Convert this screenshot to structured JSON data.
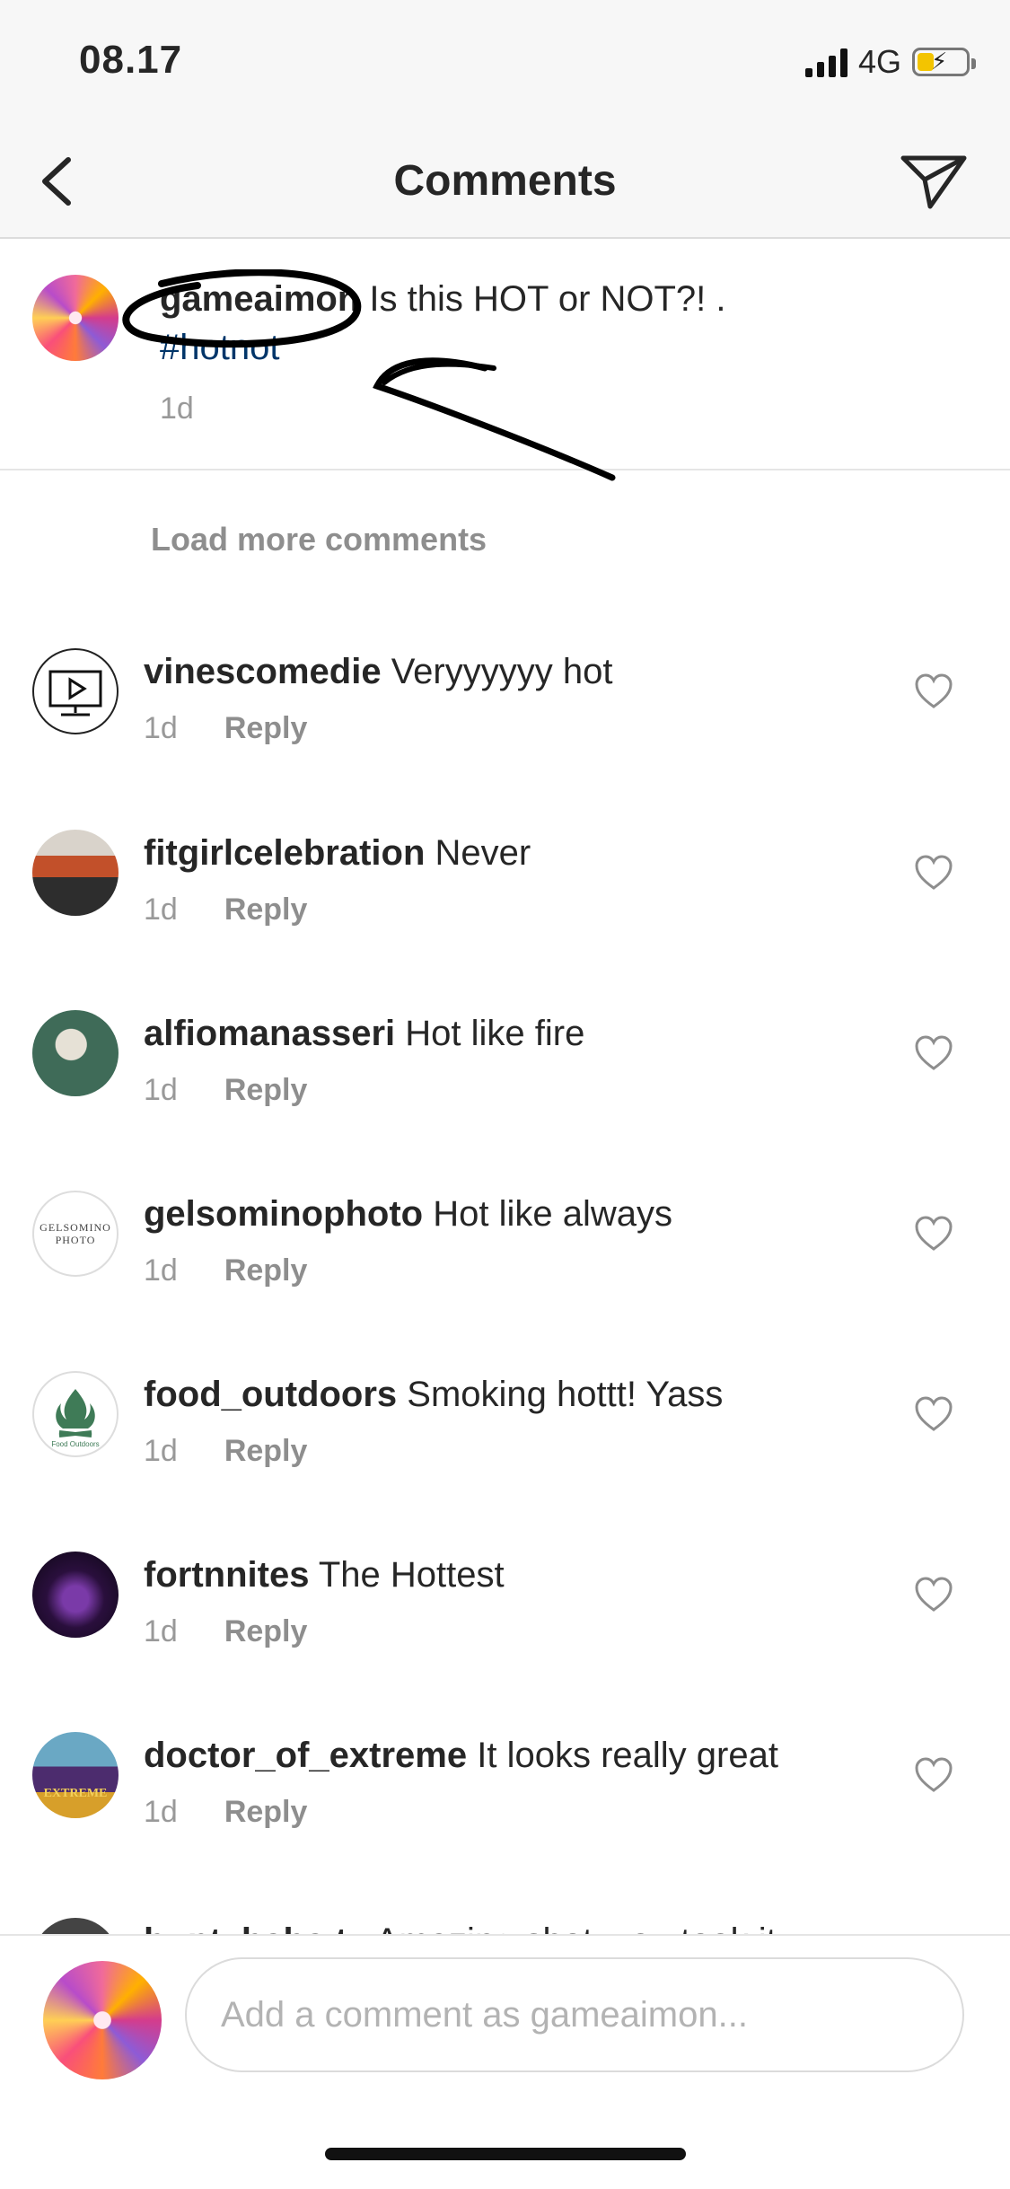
{
  "status_bar": {
    "time": "08.17",
    "network": "4G",
    "battery_level": 0.35
  },
  "nav": {
    "title": "Comments"
  },
  "caption": {
    "username": "gameaimon",
    "text": " Is this HOT or NOT?! .",
    "hashtag": "#hotnot",
    "time": "1d"
  },
  "load_more": "Load more comments",
  "comments": [
    {
      "username": "vinescomedie",
      "text": "Veryyyyyy hot",
      "time": "1d",
      "reply": "Reply"
    },
    {
      "username": "fitgirlcelebration",
      "text": "Never",
      "time": "1d",
      "reply": "Reply"
    },
    {
      "username": "alfiomanasseri",
      "text": "Hot like fire",
      "time": "1d",
      "reply": "Reply"
    },
    {
      "username": "gelsominophoto",
      "text": "Hot like always",
      "time": "1d",
      "reply": "Reply"
    },
    {
      "username": "food_outdoors",
      "text": "Smoking hottt! Yass",
      "time": "1d",
      "reply": "Reply"
    },
    {
      "username": "fortnnites",
      "text": "The Hottest",
      "time": "1d",
      "reply": "Reply"
    },
    {
      "username": "doctor_of_extreme",
      "text": "It looks really great",
      "time": "1d",
      "reply": "Reply"
    },
    {
      "username": "buntybaba.tv",
      "text": "Amazing shot, you took it"
    }
  ],
  "gelsomino_logo": {
    "line1": "GELSOMINO",
    "line2": "PHOTO"
  },
  "food_logo": "Food Outdoors",
  "doctor_logo": "EXTREME",
  "composer": {
    "placeholder": "Add a comment as gameaimon..."
  }
}
